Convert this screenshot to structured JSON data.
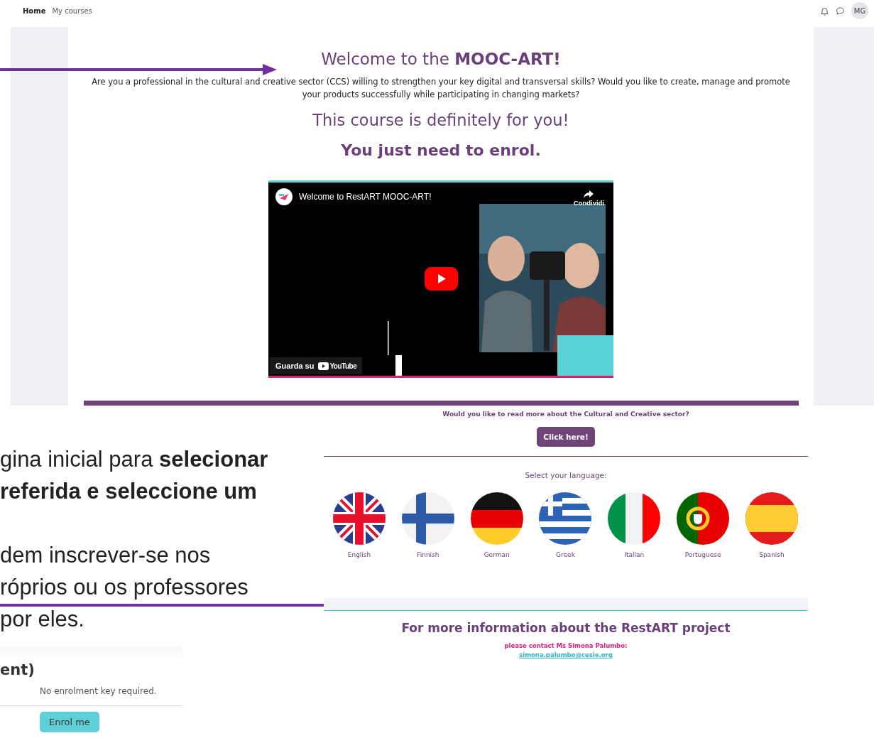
{
  "nav": {
    "links": [
      {
        "label": "Home",
        "selected": true
      },
      {
        "label": "My courses",
        "selected": false
      }
    ],
    "avatar": "MG"
  },
  "course_page": {
    "title": "Welcome to the **MOOC-ART!**",
    "intro": "Are you a professional in the cultural and creative sector (CCS) willing to strengthen your key digital and transversal skills? Would you like to create, manage and promote your products successfully while participating in changing markets?",
    "subtitle": "This course is definitely for you!",
    "call": "You just need to enrol.",
    "video": {
      "kind": "picture",
      "title": "Welcome to RestART MOOC-ART!",
      "share": "Condividi",
      "watch_on": "Guarda su",
      "platform": "YouTube"
    }
  },
  "language_page": {
    "question": "Would you like to read more about the Cultural and Creative sector?",
    "button": "Click here!",
    "prompt": "Select your language:",
    "languages": [
      {
        "label": "English",
        "kind": "uk"
      },
      {
        "label": "Finnish",
        "kind": "fi"
      },
      {
        "label": "German",
        "kind": "de"
      },
      {
        "label": "Greek",
        "kind": "gr"
      },
      {
        "label": "Italian",
        "kind": "it"
      },
      {
        "label": "Portuguese",
        "kind": "pt"
      },
      {
        "label": "Spanish",
        "kind": "es"
      }
    ],
    "info_title": "For more information about the RestART project",
    "contact": "please contact Ms Simona Palumbo:",
    "email": "simona.palumbo@cesie.org"
  },
  "slide_text": {
    "paragraphs": [
      [
        "gina inicial para **selecionar**",
        "**referida e seleccione um**"
      ],
      [
        "dem inscrever-se nos",
        "róprios ou os professores",
        "por eles."
      ]
    ]
  },
  "enrolment": {
    "heading": "ent)",
    "note": "No enrolment key required.",
    "button": "Enrol me"
  }
}
